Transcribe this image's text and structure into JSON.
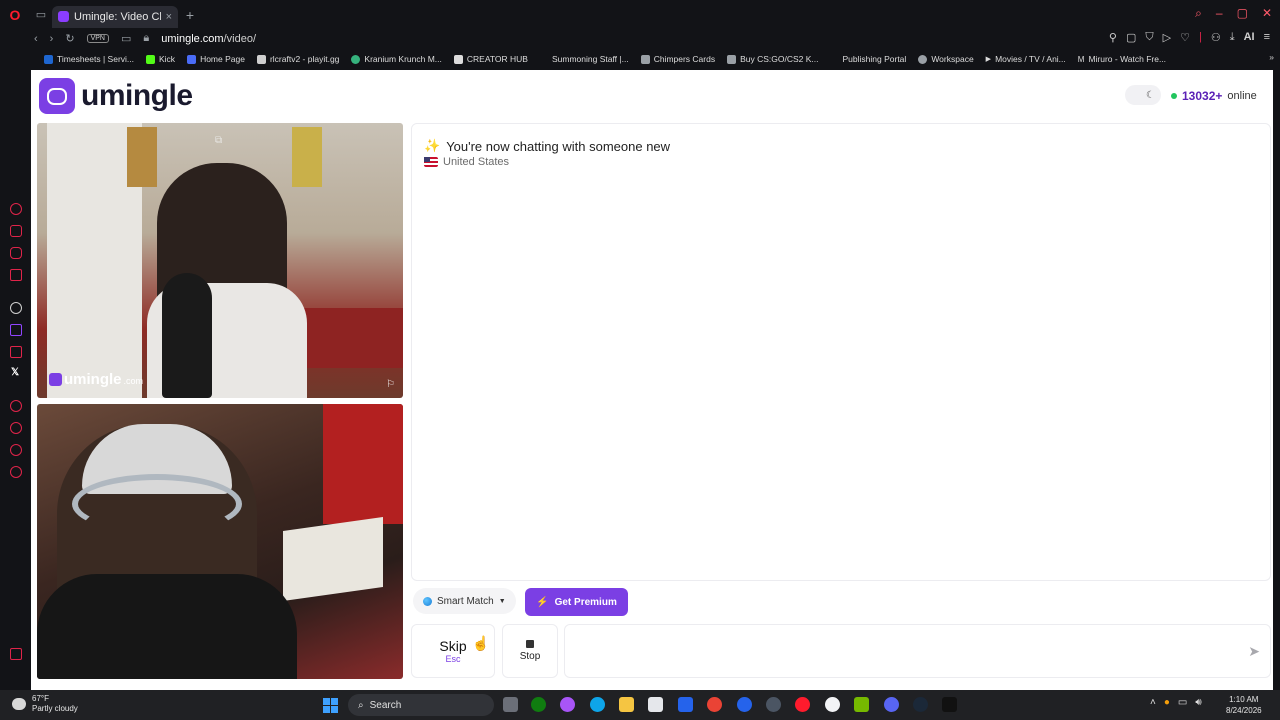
{
  "browser": {
    "tab_title": "Umingle: Video Chat wi",
    "url_host": "umingle.com",
    "url_path": "/video/",
    "vpn_label": "VPN",
    "ai_label": "AI"
  },
  "bookmarks": [
    {
      "label": "Timesheets | Servi...",
      "color": "#1e66d0"
    },
    {
      "label": "Kick",
      "color": "#53fc18"
    },
    {
      "label": "Home Page",
      "color": "#4a6cf7"
    },
    {
      "label": "rlcraftv2 - playit.gg",
      "color": "#cfcfcf"
    },
    {
      "label": "Kranium Krunch M...",
      "color": "#36b37e"
    },
    {
      "label": "CREATOR HUB",
      "color": "#dcdcdc"
    },
    {
      "label": "Summoning Staff |...",
      "color": "#121317"
    },
    {
      "label": "Chimpers Cards",
      "color": "#9aa0a6"
    },
    {
      "label": "Buy CS:GO/CS2 K...",
      "color": "#9aa0a6"
    },
    {
      "label": "Publishing Portal",
      "color": "#121317"
    },
    {
      "label": "Workspace",
      "color": "#9aa0a6"
    },
    {
      "label": "Movies / TV / Ani...",
      "color": "#dcdcdc"
    },
    {
      "label": "Miruro - Watch Fre...",
      "color": "#dcdcdc"
    }
  ],
  "site": {
    "brand": "umingle",
    "online_count": "13032+",
    "online_label": "online",
    "watermark_name": "umingle",
    "watermark_domain": ".com",
    "accent_color": "#7b3fe4"
  },
  "chat": {
    "status_message": "You're now chatting with someone new",
    "partner_country": "United States"
  },
  "controls": {
    "smart_match_label": "Smart Match",
    "premium_label": "Get Premium",
    "skip_label": "Skip",
    "skip_hint": "Esc",
    "stop_label": "Stop",
    "message_placeholder": ""
  },
  "taskbar": {
    "temperature": "67°F",
    "weather": "Partly cloudy",
    "search_label": "Search",
    "time": "1:10 AM",
    "date": "8/24/2026"
  }
}
